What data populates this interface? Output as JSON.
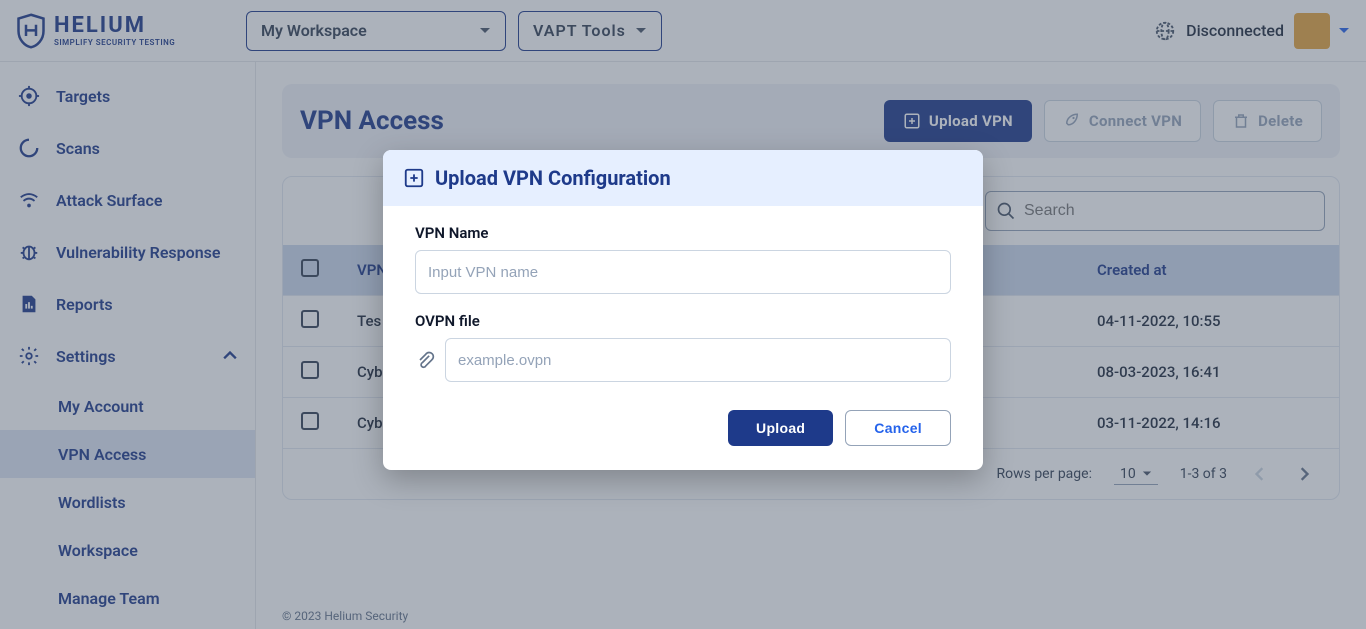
{
  "header": {
    "brand": {
      "name": "HELIUM",
      "tagline": "SIMPLIFY SECURITY TESTING"
    },
    "workspace_selected": "My Workspace",
    "tools_selected": "VAPT Tools",
    "connection_status": "Disconnected"
  },
  "sidebar": {
    "items": [
      {
        "label": "Targets"
      },
      {
        "label": "Scans"
      },
      {
        "label": "Attack Surface"
      },
      {
        "label": "Vulnerability Response"
      },
      {
        "label": "Reports"
      }
    ],
    "settings_label": "Settings",
    "settings_children": [
      {
        "label": "My Account"
      },
      {
        "label": "VPN Access"
      },
      {
        "label": "Wordlists"
      },
      {
        "label": "Workspace"
      },
      {
        "label": "Manage Team"
      }
    ]
  },
  "page": {
    "title": "VPN Access",
    "actions": {
      "upload": "Upload VPN",
      "connect": "Connect VPN",
      "delete": "Delete"
    },
    "search_placeholder": "Search",
    "table": {
      "columns": {
        "name": "VPN Name",
        "created": "Created at"
      },
      "rows": [
        {
          "name": "Tes",
          "created": "04-11-2022, 10:55"
        },
        {
          "name": "Cyb",
          "created": "08-03-2023, 16:41"
        },
        {
          "name": "Cyb",
          "created": "03-11-2022, 14:16"
        }
      ]
    },
    "pagination": {
      "rows_per_page_label": "Rows per page:",
      "rows_per_page_value": "10",
      "range": "1-3 of 3"
    }
  },
  "modal": {
    "title": "Upload VPN Configuration",
    "vpn_name_label": "VPN Name",
    "vpn_name_placeholder": "Input VPN name",
    "ovpn_label": "OVPN file",
    "ovpn_placeholder": "example.ovpn",
    "upload_label": "Upload",
    "cancel_label": "Cancel"
  },
  "footer": {
    "copyright": "© 2023 Helium Security"
  }
}
